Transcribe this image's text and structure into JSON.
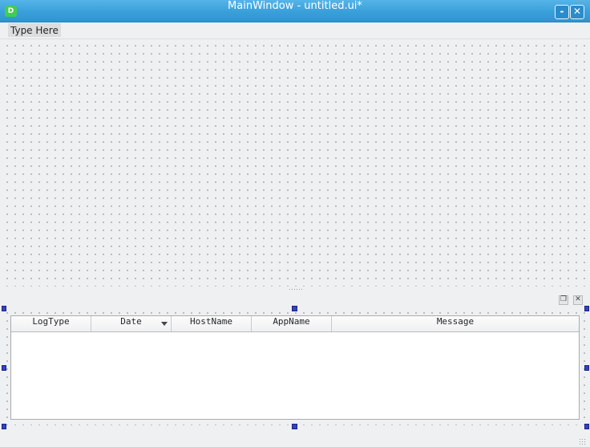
{
  "window": {
    "title": "MainWindow - untitled.ui*",
    "app_icon_letter": "D",
    "minimize_glyph": "-",
    "close_glyph": "✕"
  },
  "menubar": {
    "placeholder": "Type Here"
  },
  "dock": {
    "float_glyph": "❐",
    "close_glyph": "✕"
  },
  "table": {
    "columns": [
      "LogType",
      "Date",
      "HostName",
      "AppName",
      "Message"
    ],
    "sorted_column": "Date",
    "rows": []
  },
  "colors": {
    "titlebar": "#3aa0da",
    "selection_handle": "#3344bb"
  }
}
